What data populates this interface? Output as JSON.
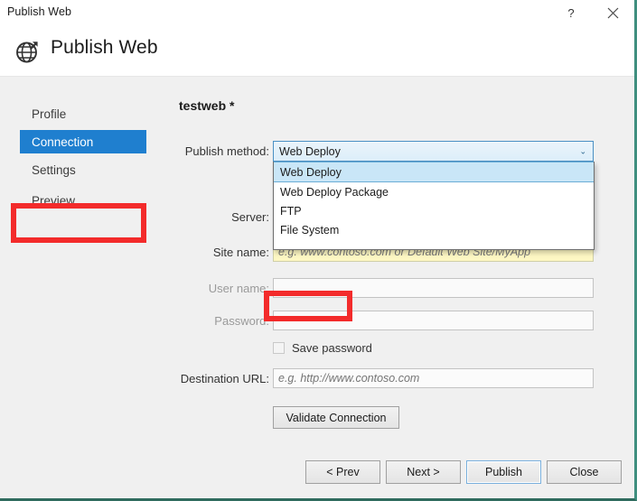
{
  "titlebar": {
    "title": "Publish Web",
    "help_label": "?",
    "close_label": "✕"
  },
  "header": {
    "title": "Publish Web",
    "icon": "globe-publish-icon"
  },
  "sidebar": {
    "items": [
      {
        "label": "Profile",
        "selected": false
      },
      {
        "label": "Connection",
        "selected": true
      },
      {
        "label": "Settings",
        "selected": false
      },
      {
        "label": "Preview",
        "selected": false
      }
    ]
  },
  "main": {
    "profile_title": "testweb *",
    "publish_method": {
      "label": "Publish method:",
      "selected": "Web Deploy",
      "arrow": "⌄",
      "options": [
        "Web Deploy",
        "Web Deploy Package",
        "FTP",
        "File System"
      ]
    },
    "fields": [
      {
        "label": "Server:",
        "value": "",
        "placeholder": "",
        "disabled": false
      },
      {
        "label": "Site name:",
        "value": "",
        "placeholder": "e.g. www.contoso.com or Default Web Site/MyApp",
        "disabled": false
      },
      {
        "label": "User name:",
        "value": "",
        "placeholder": "",
        "disabled": true
      },
      {
        "label": "Password:",
        "value": "",
        "placeholder": "",
        "disabled": true
      }
    ],
    "save_password": {
      "label": "Save password",
      "checked": false
    },
    "destination_url": {
      "label": "Destination URL:",
      "value": "",
      "placeholder": "e.g. http://www.contoso.com"
    },
    "validate_button": "Validate Connection"
  },
  "footer": {
    "prev": "< Prev",
    "next": "Next >",
    "publish": "Publish",
    "close": "Close"
  },
  "annotations": {
    "color": "#f32b2b",
    "targets": [
      "Connection",
      "File System"
    ]
  }
}
